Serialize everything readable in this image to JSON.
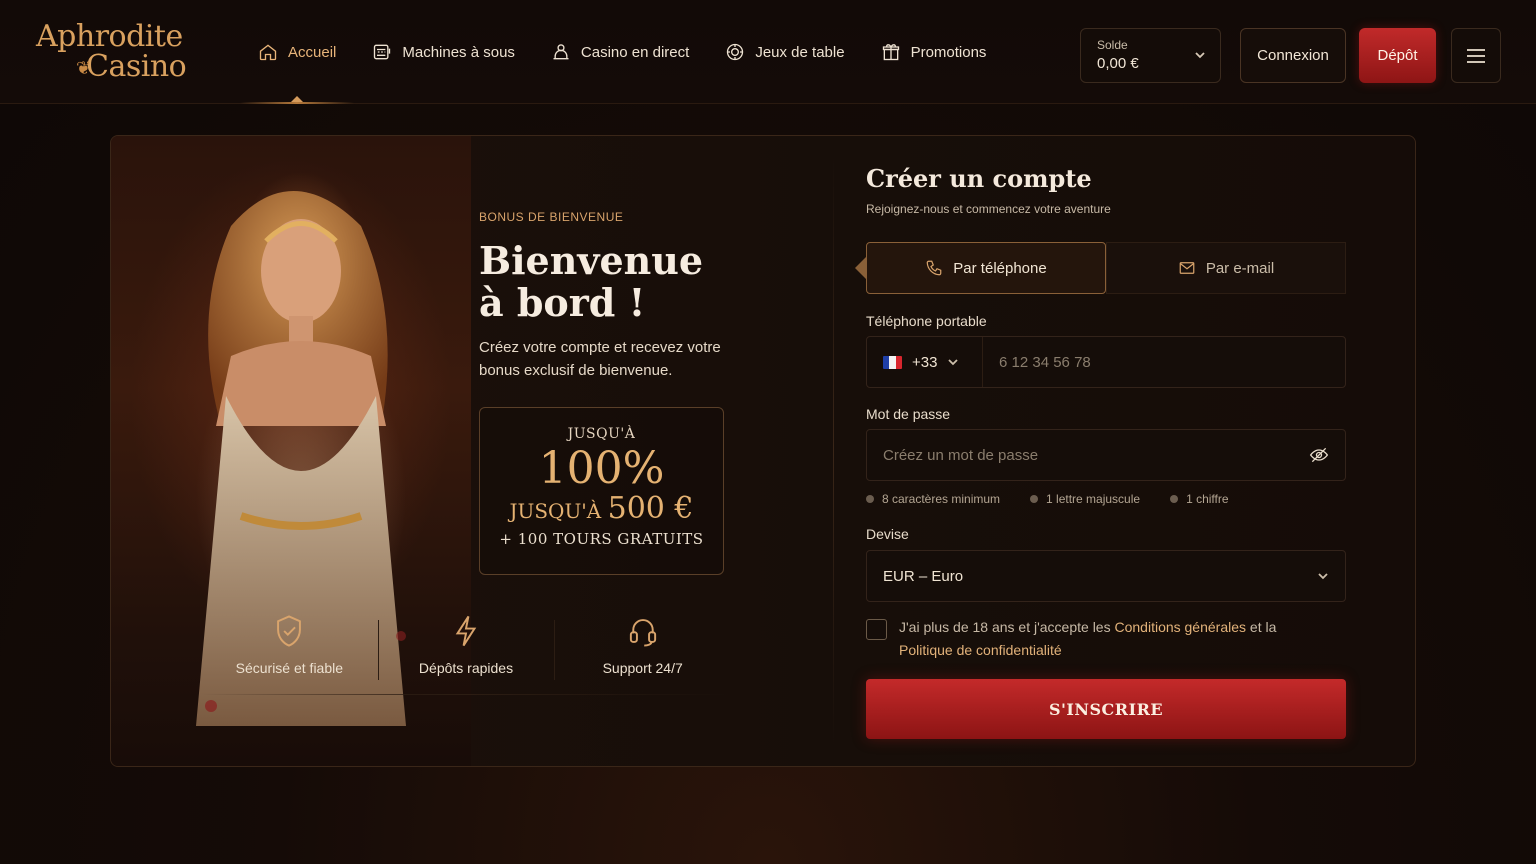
{
  "brand": {
    "line1": "Aphrodite",
    "line2": "Casino"
  },
  "nav": {
    "items": [
      {
        "label": "Accueil",
        "icon": "home-icon",
        "active": true
      },
      {
        "label": "Machines à sous",
        "icon": "slot-machine-icon"
      },
      {
        "label": "Casino en direct",
        "icon": "live-dealer-icon"
      },
      {
        "label": "Jeux de table",
        "icon": "chip-icon"
      },
      {
        "label": "Promotions",
        "icon": "gift-icon"
      }
    ]
  },
  "header": {
    "balance_label": "Solde",
    "balance_value": "0,00 €",
    "login_label": "Connexion",
    "deposit_label": "Dépôt",
    "menu_icon": "hamburger-icon"
  },
  "hero": {
    "kicker": "BONUS DE BIENVENUE",
    "title_line1": "Bienvenue",
    "title_line2": "à bord !",
    "intro": "Créez votre compte et recevez votre bonus exclusif de bienvenue.",
    "bonus": {
      "up_to": "JUSQU'À",
      "percent": "100%",
      "amount_prefix": "JUSQU'À",
      "amount": "500 €",
      "spins": "+ 100 TOURS GRATUITS"
    },
    "features": [
      {
        "label": "Sécurisé et fiable",
        "icon": "shield-check-icon"
      },
      {
        "label": "Dépôts rapides",
        "icon": "lightning-icon"
      },
      {
        "label": "Support 24/7",
        "icon": "headset-icon"
      }
    ]
  },
  "form": {
    "title": "Créer un compte",
    "subtitle": "Rejoignez-nous et commencez votre aventure",
    "tabs": [
      {
        "label": "Par téléphone",
        "icon": "phone-icon",
        "active": true
      },
      {
        "label": "Par e-mail",
        "icon": "mail-icon"
      }
    ],
    "phone_label": "Téléphone portable",
    "phone_prefix": "+33",
    "phone_placeholder": "6 12 34 56 78",
    "password_label": "Mot de passe",
    "password_placeholder": "Créez un mot de passe",
    "password_rules": [
      "8 caractères minimum",
      "1 lettre majuscule",
      "1 chiffre"
    ],
    "currency_label": "Devise",
    "currency_value": "EUR – Euro",
    "consent_part1": "J'ai plus de 18 ans et j'accepte les ",
    "consent_terms": "Conditions générales",
    "consent_part2": " et la ",
    "consent_privacy": "Politique de confidentialité",
    "submit_label": "S'INSCRIRE"
  },
  "colors": {
    "accent": "#d9a46c",
    "primary_red": "#b32222",
    "background": "#120a07"
  }
}
